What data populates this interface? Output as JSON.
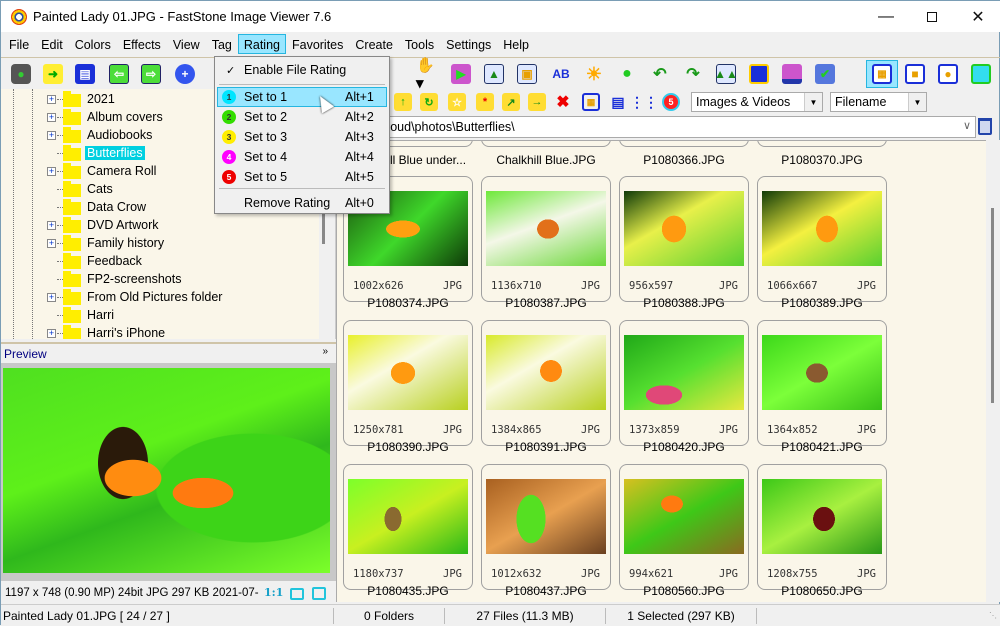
{
  "window": {
    "title": "Painted Lady 01.JPG  -  FastStone Image Viewer 7.6",
    "controls": [
      "minimize",
      "maximize",
      "close"
    ]
  },
  "menubar": [
    "File",
    "Edit",
    "Colors",
    "Effects",
    "View",
    "Tag",
    "Rating",
    "Favorites",
    "Create",
    "Tools",
    "Settings",
    "Help"
  ],
  "active_menu": "Rating",
  "rating_menu": {
    "enable": {
      "label": "Enable File Rating",
      "checked": true
    },
    "items": [
      {
        "badge": "1",
        "label": "Set to 1",
        "shortcut": "Alt+1",
        "color": "#00e5ff",
        "highlighted": true
      },
      {
        "badge": "2",
        "label": "Set to 2",
        "shortcut": "Alt+2",
        "color": "#33dd00"
      },
      {
        "badge": "3",
        "label": "Set to 3",
        "shortcut": "Alt+3",
        "color": "#ffee00"
      },
      {
        "badge": "4",
        "label": "Set to 4",
        "shortcut": "Alt+4",
        "color": "#ff00ff"
      },
      {
        "badge": "5",
        "label": "Set to 5",
        "shortcut": "Alt+5",
        "color": "#ee0000"
      }
    ],
    "remove": {
      "label": "Remove Rating",
      "shortcut": "Alt+0"
    }
  },
  "toolbar": {
    "left_icons": [
      "camera-icon",
      "open-folder-icon",
      "save-icon",
      "previous-icon",
      "next-icon",
      "zoom-in-icon"
    ],
    "right_icons": [
      "hand-pan-icon",
      "slideshow-icon",
      "compare-icon",
      "crop-icon",
      "text-icon",
      "brightness-icon",
      "wallpaper-icon",
      "rotate-left-icon",
      "rotate-right-icon",
      "side-by-side-icon",
      "full-screen-preview-icon",
      "print-icon",
      "check-icon",
      "layout-thumbnails-icon",
      "layout-preview-icon",
      "layout-single-icon",
      "full-screen-icon"
    ]
  },
  "filterbar": {
    "icons": [
      "folder-up-icon",
      "folder-refresh-icon",
      "folder-favorite-icon",
      "new-folder-icon",
      "copy-to-icon",
      "move-to-icon",
      "delete-icon",
      "thumbnail-view-icon",
      "list-view-icon",
      "details-view-icon",
      "rating-filter-icon"
    ],
    "filter_select": "Images & Videos",
    "sort_select": "Filename"
  },
  "path": "k\\NextCloud\\photos\\Butterflies\\",
  "folder_tree": [
    {
      "label": "2021",
      "expandable": true
    },
    {
      "label": "Album covers",
      "expandable": true
    },
    {
      "label": "Audiobooks",
      "expandable": true
    },
    {
      "label": "Butterflies",
      "expandable": false,
      "selected": true
    },
    {
      "label": "Camera Roll",
      "expandable": true
    },
    {
      "label": "Cats",
      "expandable": false
    },
    {
      "label": "Data Crow",
      "expandable": false
    },
    {
      "label": "DVD Artwork",
      "expandable": true
    },
    {
      "label": "Family history",
      "expandable": true
    },
    {
      "label": "Feedback",
      "expandable": false
    },
    {
      "label": "FP2-screenshots",
      "expandable": false
    },
    {
      "label": "From Old Pictures folder",
      "expandable": true
    },
    {
      "label": "Harri",
      "expandable": false
    },
    {
      "label": "Harri's iPhone",
      "expandable": true
    }
  ],
  "preview": {
    "title": "Preview",
    "info": "1197 x 748 (0.90 MP)  24bit  JPG   297 KB   2021-07-",
    "actual_size_label": "1:1"
  },
  "top_row_names": [
    "Chalkhill Blue under...",
    "Chalkhill Blue.JPG",
    "P1080366.JPG",
    "P1080370.JPG"
  ],
  "thumbnails": [
    {
      "name": "P1080374.JPG",
      "dims": "1002x626",
      "ext": "JPG"
    },
    {
      "name": "P1080387.JPG",
      "dims": "1136x710",
      "ext": "JPG"
    },
    {
      "name": "P1080388.JPG",
      "dims": "956x597",
      "ext": "JPG"
    },
    {
      "name": "P1080389.JPG",
      "dims": "1066x667",
      "ext": "JPG"
    },
    {
      "name": "P1080390.JPG",
      "dims": "1250x781",
      "ext": "JPG"
    },
    {
      "name": "P1080391.JPG",
      "dims": "1384x865",
      "ext": "JPG"
    },
    {
      "name": "P1080420.JPG",
      "dims": "1373x859",
      "ext": "JPG"
    },
    {
      "name": "P1080421.JPG",
      "dims": "1364x852",
      "ext": "JPG"
    },
    {
      "name": "P1080435.JPG",
      "dims": "1180x737",
      "ext": "JPG"
    },
    {
      "name": "P1080437.JPG",
      "dims": "1012x632",
      "ext": "JPG"
    },
    {
      "name": "P1080560.JPG",
      "dims": "994x621",
      "ext": "JPG"
    },
    {
      "name": "P1080650.JPG",
      "dims": "1208x755",
      "ext": "JPG"
    }
  ],
  "statusbar": {
    "current": "Painted Lady 01.JPG [ 24 / 27 ]",
    "folders": "0 Folders",
    "files": "27 Files (11.3 MB)",
    "selected": "1 Selected (297 KB)"
  }
}
